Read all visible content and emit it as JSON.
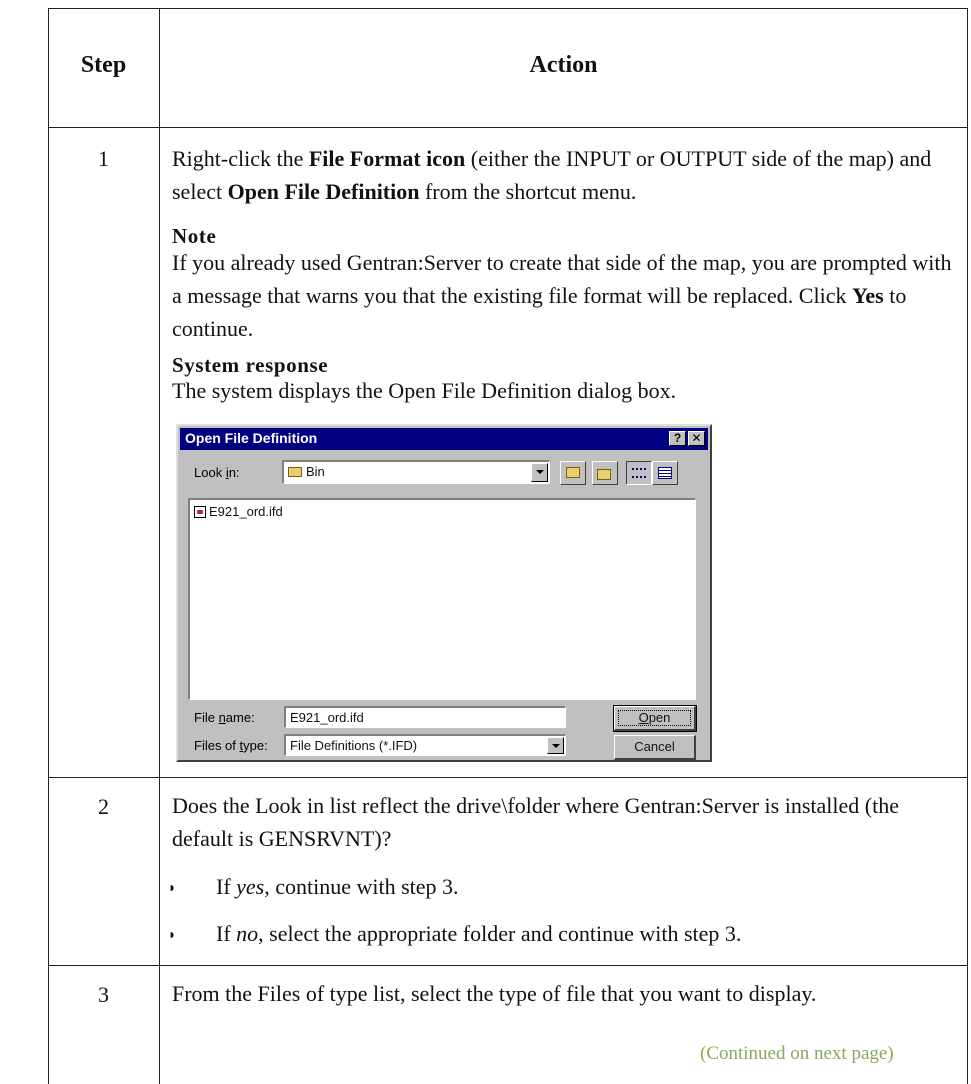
{
  "table": {
    "header_step": "Step",
    "header_action": "Action"
  },
  "step1": {
    "number": "1",
    "pre1": "Right-click the ",
    "bold1": "File Format icon",
    "mid1": " (either the INPUT or OUTPUT side of the map) and select ",
    "bold2": "Open File Definition",
    "post1": " from the shortcut menu.",
    "note_heading": "Note",
    "note_text": "If you already used Gentran:Server to create that side of the map, you are prompted with a message that warns you that the existing file format will be replaced. Click ",
    "note_bold": "Yes",
    "note_post": " to continue.",
    "response_heading": "System response",
    "response_text": "The system displays the Open File Definition dialog box."
  },
  "dialog": {
    "title": "Open File Definition",
    "help_btn": "?",
    "close_btn": "✕",
    "look_in_label": "Look in:",
    "look_in_value": "Bin",
    "file_item": "E921_ord.ifd",
    "file_name_label": "File name:",
    "file_name_value": "E921_ord.ifd",
    "files_type_label": "Files of type:",
    "files_type_value": "File Definitions (*.IFD)",
    "open_label": "Open",
    "cancel_label": "Cancel"
  },
  "step2": {
    "number": "2",
    "text": "Does the Look in list reflect the drive\\folder where Gentran:Server is installed (the default is GENSRVNT)?",
    "bullet1_em": "yes",
    "bullet1_pre": "If ",
    "bullet1_post": ", continue with step 3.",
    "bullet2_em": "no",
    "bullet2_pre": "If ",
    "bullet2_post": ", select the appropriate folder and continue with step 3."
  },
  "step3": {
    "number": "3",
    "text": "From the Files of type list, select the type of file that you want to display."
  },
  "continued": "(Continued on next page)"
}
